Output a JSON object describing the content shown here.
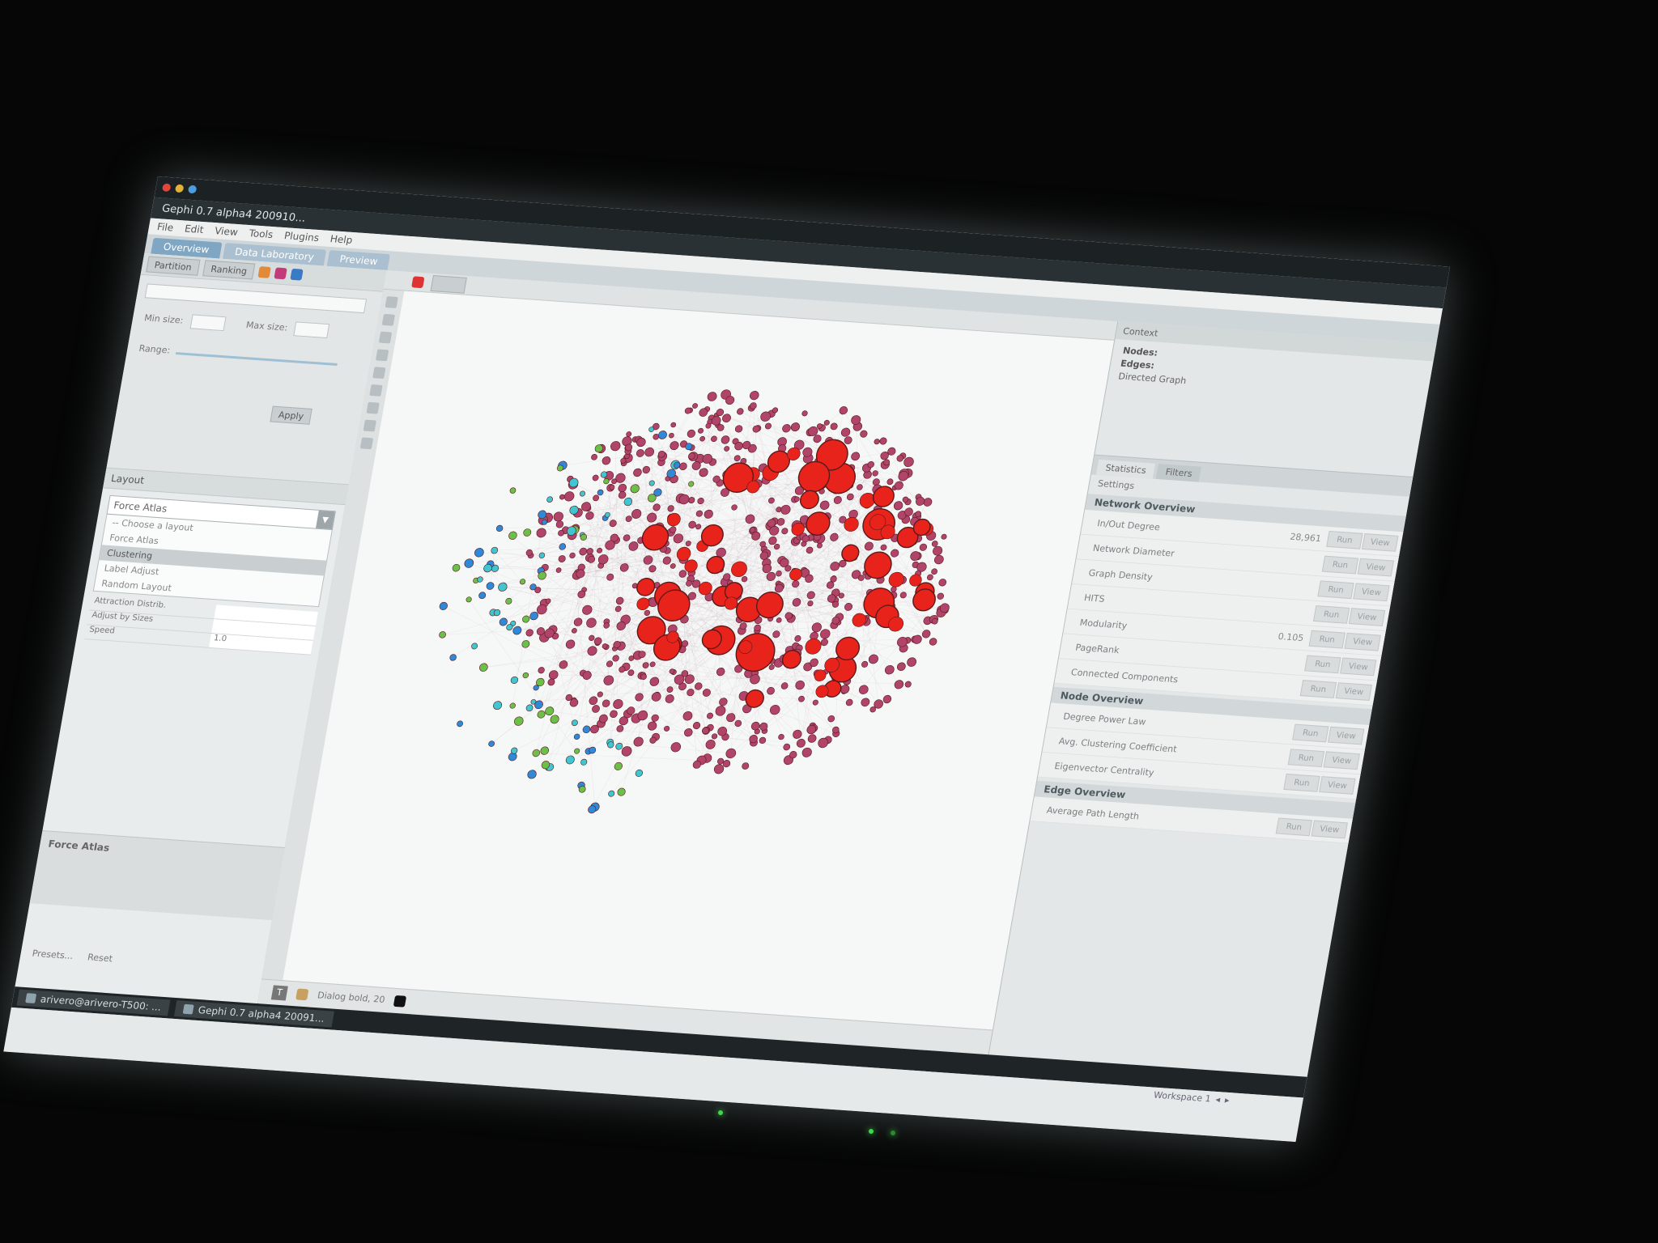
{
  "window": {
    "title": "Gephi 0.7 alpha4 200910...",
    "menu": [
      "File",
      "Edit",
      "View",
      "Tools",
      "Plugins",
      "Help"
    ]
  },
  "tabs": [
    {
      "label": "Overview",
      "active": true
    },
    {
      "label": "Data Laboratory",
      "active": false
    },
    {
      "label": "Preview",
      "active": false
    }
  ],
  "left_panel": {
    "toolbar_items": [
      "Partition",
      "Ranking"
    ],
    "filter": {
      "min_size_label": "Min size:",
      "max_size_label": "Max size:",
      "range_label": "Range:",
      "apply_label": "Apply"
    },
    "layout": {
      "header": "Layout",
      "selected": "Force Atlas",
      "options": [
        "-- Choose a layout",
        "Force Atlas",
        "Clustering",
        "Label Adjust",
        "Random Layout"
      ],
      "selected_option_index": 2,
      "properties": [
        {
          "key": "Attraction Distrib.",
          "value": ""
        },
        {
          "key": "Adjust by Sizes",
          "value": ""
        },
        {
          "key": "Speed",
          "value": "1.0"
        }
      ],
      "description_title": "Force Atlas",
      "presets_label": "Presets...",
      "reset_label": "Reset"
    }
  },
  "graph": {
    "bottom_font": "Dialog bold, 20",
    "text_tool_label": "T"
  },
  "right_panel": {
    "context_header": "Context",
    "nodes_label": "Nodes:",
    "edges_label": "Edges:",
    "graph_type": "Directed Graph",
    "stats_tabs": [
      "Statistics",
      "Filters"
    ],
    "settings_label": "Settings",
    "sections": [
      {
        "title": "Network Overview",
        "rows": [
          {
            "name": "In/Out Degree",
            "value": "28,961"
          },
          {
            "name": "Network Diameter",
            "value": ""
          },
          {
            "name": "Graph Density",
            "value": ""
          },
          {
            "name": "HITS",
            "value": ""
          },
          {
            "name": "Modularity",
            "value": "0.105"
          },
          {
            "name": "PageRank",
            "value": ""
          },
          {
            "name": "Connected Components",
            "value": ""
          }
        ]
      },
      {
        "title": "Node Overview",
        "rows": [
          {
            "name": "Degree Power Law",
            "value": ""
          },
          {
            "name": "Avg. Clustering Coefficient",
            "value": ""
          },
          {
            "name": "Eigenvector Centrality",
            "value": ""
          }
        ]
      },
      {
        "title": "Edge Overview",
        "rows": [
          {
            "name": "Average Path Length",
            "value": ""
          }
        ]
      }
    ],
    "run_label": "Run",
    "view_label": "View"
  },
  "taskbar": {
    "tasks": [
      "arivero@arivero-T500: ...",
      "Gephi 0.7 alpha4 20091..."
    ],
    "workspace": "Workspace 1"
  },
  "colors": {
    "hub_node": "#e8231c",
    "member_node": "#b0446a",
    "peripheral_blue": "#2f88d8",
    "peripheral_cyan": "#3fc6d0",
    "peripheral_green": "#6cc04a",
    "accent_tab": "#7fa7c4"
  }
}
